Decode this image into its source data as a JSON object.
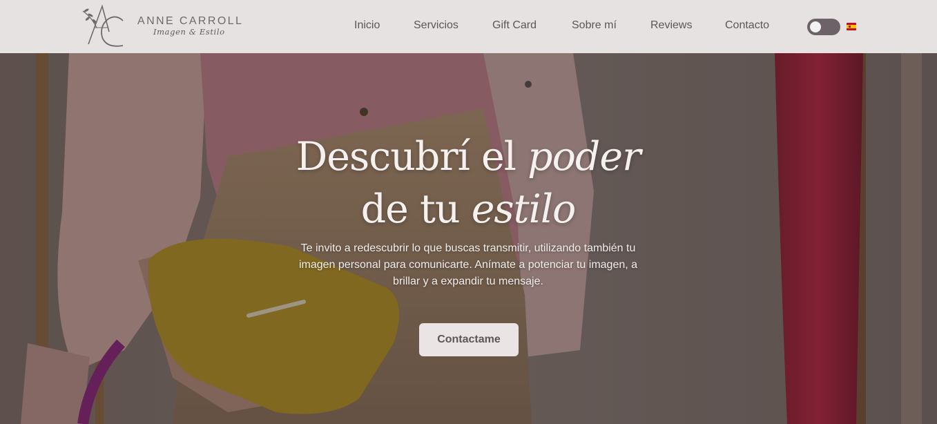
{
  "brand": {
    "name": "ANNE CARROLL",
    "tagline": "Imagen & Estilo",
    "monogram_icon": "ac-monogram-logo-icon"
  },
  "nav": {
    "items": [
      {
        "label": "Inicio"
      },
      {
        "label": "Servicios"
      },
      {
        "label": "Gift Card"
      },
      {
        "label": "Sobre mí"
      },
      {
        "label": "Reviews"
      },
      {
        "label": "Contacto"
      }
    ],
    "theme_toggle_icon": "theme-toggle-switch",
    "language_flag_icon": "spain-flag-icon"
  },
  "hero": {
    "title_line1_plain": "Descubrí el ",
    "title_line1_italic": "poder",
    "title_line2_plain": "de tu ",
    "title_line2_italic": "estilo",
    "subtitle": "Te invito a redescubrir lo que buscas transmitir, utilizando también tu imagen personal para comunicarte. Anímate a potenciar tu imagen, a brillar y a expandir tu mensaje.",
    "cta_label": "Contactame"
  },
  "colors": {
    "header_bg": "#e6e2e1",
    "nav_text": "#5a5659",
    "toggle_bg": "#6d6267",
    "cta_bg": "#eae5e4",
    "cta_text": "#5d5559",
    "hero_text": "#f6f1ef"
  }
}
